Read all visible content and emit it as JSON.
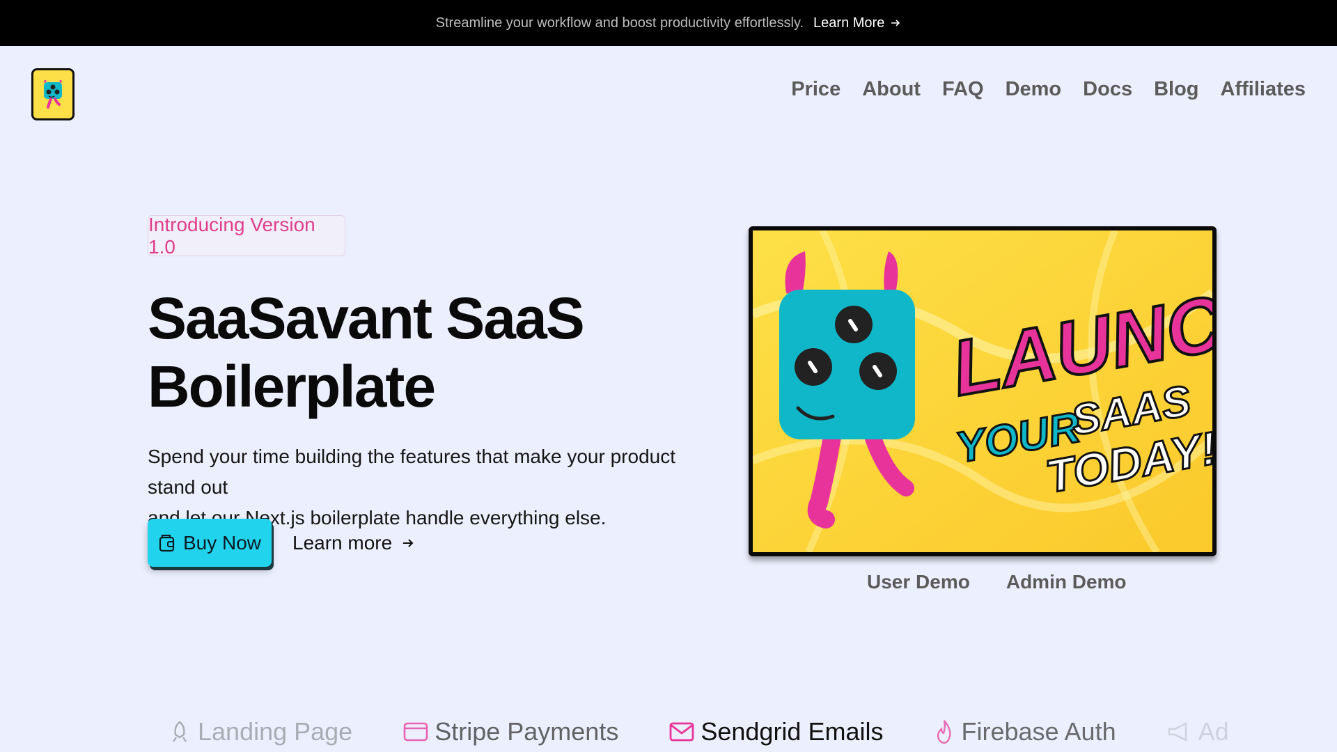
{
  "announcement": {
    "message": "Streamline your workflow and boost productivity effortlessly.",
    "cta_label": "Learn More",
    "arrow_icon": "arrow-right-icon"
  },
  "header": {
    "logo_icon": "monster-logo-icon",
    "nav": [
      {
        "label": "Price"
      },
      {
        "label": "About"
      },
      {
        "label": "FAQ"
      },
      {
        "label": "Demo"
      },
      {
        "label": "Docs"
      },
      {
        "label": "Blog"
      },
      {
        "label": "Affiliates"
      }
    ]
  },
  "hero": {
    "badge": "Introducing Version 1.0",
    "title_line1": "SaaSavant SaaS",
    "title_line2": "Boilerplate",
    "description_line1": "Spend your time building the features that make your product stand out",
    "description_line2": "and let our Next.js boilerplate handle everything else.",
    "buy_label": "Buy Now",
    "buy_icon": "wallet-icon",
    "learn_label": "Learn more",
    "image": {
      "line1": "LAUNCH",
      "line2_a": "YOUR",
      "line2_b": "SAAS",
      "line3": "TODAY!"
    },
    "demo_links": [
      {
        "label": "User Demo"
      },
      {
        "label": "Admin Demo"
      }
    ]
  },
  "features": [
    {
      "label": "Landing Page",
      "icon": "rocket-icon"
    },
    {
      "label": "Stripe Payments",
      "icon": "credit-card-icon"
    },
    {
      "label": "Sendgrid Emails",
      "icon": "mail-icon"
    },
    {
      "label": "Firebase Auth",
      "icon": "flame-icon"
    },
    {
      "label": "Ad",
      "icon": "megaphone-icon"
    }
  ],
  "colors": {
    "accent_cyan": "#22d3ee",
    "accent_pink": "#e03e8c",
    "page_bg": "#eceffd",
    "logo_yellow": "#fde047"
  }
}
